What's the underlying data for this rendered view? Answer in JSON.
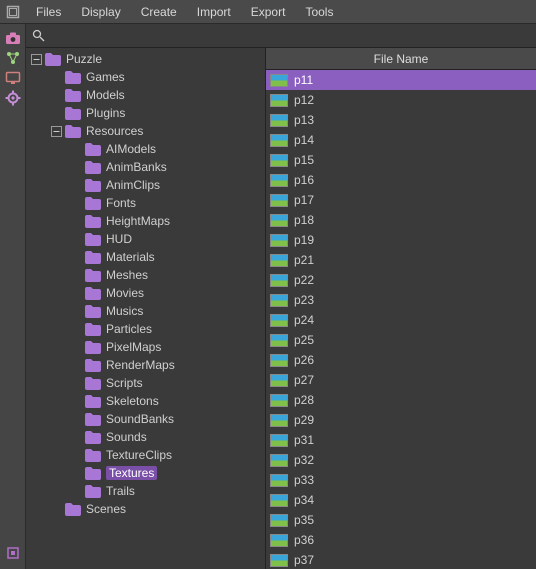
{
  "menu": {
    "items": [
      "Files",
      "Display",
      "Create",
      "Import",
      "Export",
      "Tools"
    ]
  },
  "search": {
    "placeholder": ""
  },
  "sidebar_tools": [
    {
      "name": "camera-icon",
      "color": "#d97fb8"
    },
    {
      "name": "nodes-icon",
      "color": "#9fd47f"
    },
    {
      "name": "monitor-icon",
      "color": "#d07f7f"
    },
    {
      "name": "gear-icon",
      "color": "#c48fd8"
    }
  ],
  "sidebar_bottom": {
    "name": "component-icon",
    "color": "#b06fc8"
  },
  "folder_color": "#a877d6",
  "tree": {
    "root": {
      "label": "Puzzle",
      "expanded": true,
      "children": [
        {
          "label": "Games"
        },
        {
          "label": "Models"
        },
        {
          "label": "Plugins"
        },
        {
          "label": "Resources",
          "expanded": true,
          "children": [
            {
              "label": "AIModels"
            },
            {
              "label": "AnimBanks"
            },
            {
              "label": "AnimClips"
            },
            {
              "label": "Fonts"
            },
            {
              "label": "HeightMaps"
            },
            {
              "label": "HUD"
            },
            {
              "label": "Materials"
            },
            {
              "label": "Meshes"
            },
            {
              "label": "Movies"
            },
            {
              "label": "Musics"
            },
            {
              "label": "Particles"
            },
            {
              "label": "PixelMaps"
            },
            {
              "label": "RenderMaps"
            },
            {
              "label": "Scripts"
            },
            {
              "label": "Skeletons"
            },
            {
              "label": "SoundBanks"
            },
            {
              "label": "Sounds"
            },
            {
              "label": "TextureClips"
            },
            {
              "label": "Textures",
              "selected": true
            },
            {
              "label": "Trails"
            }
          ]
        },
        {
          "label": "Scenes"
        }
      ]
    }
  },
  "file_list": {
    "header": "File Name",
    "selected_index": 0,
    "items": [
      "p11",
      "p12",
      "p13",
      "p14",
      "p15",
      "p16",
      "p17",
      "p18",
      "p19",
      "p21",
      "p22",
      "p23",
      "p24",
      "p25",
      "p26",
      "p27",
      "p28",
      "p29",
      "p31",
      "p32",
      "p33",
      "p34",
      "p35",
      "p36",
      "p37"
    ]
  }
}
